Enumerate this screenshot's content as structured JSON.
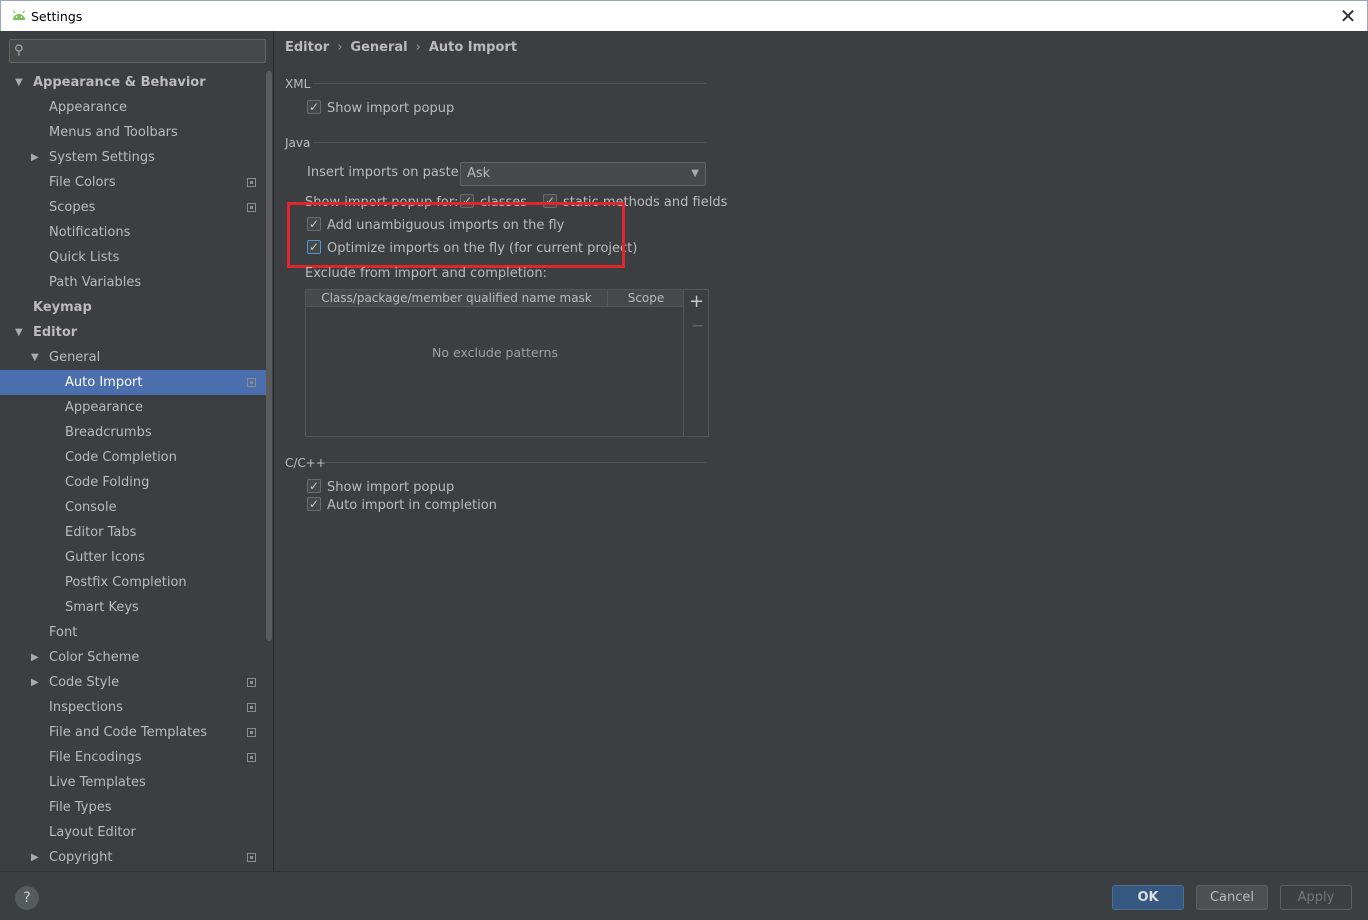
{
  "window": {
    "title": "Settings"
  },
  "search": {
    "placeholder": ""
  },
  "tree": [
    {
      "label": "Appearance & Behavior",
      "bold": true,
      "arrow": "down",
      "level": 0
    },
    {
      "label": "Appearance",
      "level": 1
    },
    {
      "label": "Menus and Toolbars",
      "level": 1
    },
    {
      "label": "System Settings",
      "level": 1,
      "arrow": "right"
    },
    {
      "label": "File Colors",
      "level": 1,
      "project": true
    },
    {
      "label": "Scopes",
      "level": 1,
      "project": true
    },
    {
      "label": "Notifications",
      "level": 1
    },
    {
      "label": "Quick Lists",
      "level": 1
    },
    {
      "label": "Path Variables",
      "level": 1
    },
    {
      "label": "Keymap",
      "bold": true,
      "level": 0
    },
    {
      "label": "Editor",
      "bold": true,
      "arrow": "down",
      "level": 0
    },
    {
      "label": "General",
      "level": 1,
      "arrow": "down"
    },
    {
      "label": "Auto Import",
      "level": 2,
      "selected": true,
      "project": true
    },
    {
      "label": "Appearance",
      "level": 2
    },
    {
      "label": "Breadcrumbs",
      "level": 2
    },
    {
      "label": "Code Completion",
      "level": 2
    },
    {
      "label": "Code Folding",
      "level": 2
    },
    {
      "label": "Console",
      "level": 2
    },
    {
      "label": "Editor Tabs",
      "level": 2
    },
    {
      "label": "Gutter Icons",
      "level": 2
    },
    {
      "label": "Postfix Completion",
      "level": 2
    },
    {
      "label": "Smart Keys",
      "level": 2
    },
    {
      "label": "Font",
      "level": 1
    },
    {
      "label": "Color Scheme",
      "level": 1,
      "arrow": "right"
    },
    {
      "label": "Code Style",
      "level": 1,
      "arrow": "right",
      "project": true
    },
    {
      "label": "Inspections",
      "level": 1,
      "project": true
    },
    {
      "label": "File and Code Templates",
      "level": 1,
      "project": true
    },
    {
      "label": "File Encodings",
      "level": 1,
      "project": true
    },
    {
      "label": "Live Templates",
      "level": 1
    },
    {
      "label": "File Types",
      "level": 1
    },
    {
      "label": "Layout Editor",
      "level": 1
    },
    {
      "label": "Copyright",
      "level": 1,
      "arrow": "right",
      "project": true
    }
  ],
  "breadcrumb": [
    "Editor",
    "General",
    "Auto Import"
  ],
  "xml": {
    "section": "XML",
    "show_import_popup": {
      "label": "Show import popup",
      "checked": true
    }
  },
  "java": {
    "section": "Java",
    "insert_on_paste_label": "Insert imports on paste:",
    "insert_on_paste_value": "Ask",
    "show_popup_for_label": "Show import popup for:",
    "popup_classes": {
      "label": "classes",
      "checked": true
    },
    "popup_static": {
      "label": "static methods and fields",
      "checked": true
    },
    "add_unambiguous": {
      "label": "Add unambiguous imports on the fly",
      "checked": true
    },
    "optimize_imports": {
      "label": "Optimize imports on the fly (for current project)",
      "checked": true
    },
    "exclude_label": "Exclude from import and completion:",
    "table": {
      "columns": [
        "Class/package/member qualified name mask",
        "Scope"
      ],
      "empty_text": "No exclude patterns",
      "add": "+",
      "remove": "−"
    }
  },
  "cpp": {
    "section": "C/C++",
    "show_import_popup": {
      "label": "Show import popup",
      "checked": true
    },
    "auto_import_completion": {
      "label": "Auto import in completion",
      "checked": true
    }
  },
  "buttons": {
    "help": "?",
    "ok": "OK",
    "cancel": "Cancel",
    "apply": "Apply"
  },
  "colors": {
    "selection": "#4b6eaf",
    "highlight": "#e0262c",
    "background": "#3c3f41"
  }
}
